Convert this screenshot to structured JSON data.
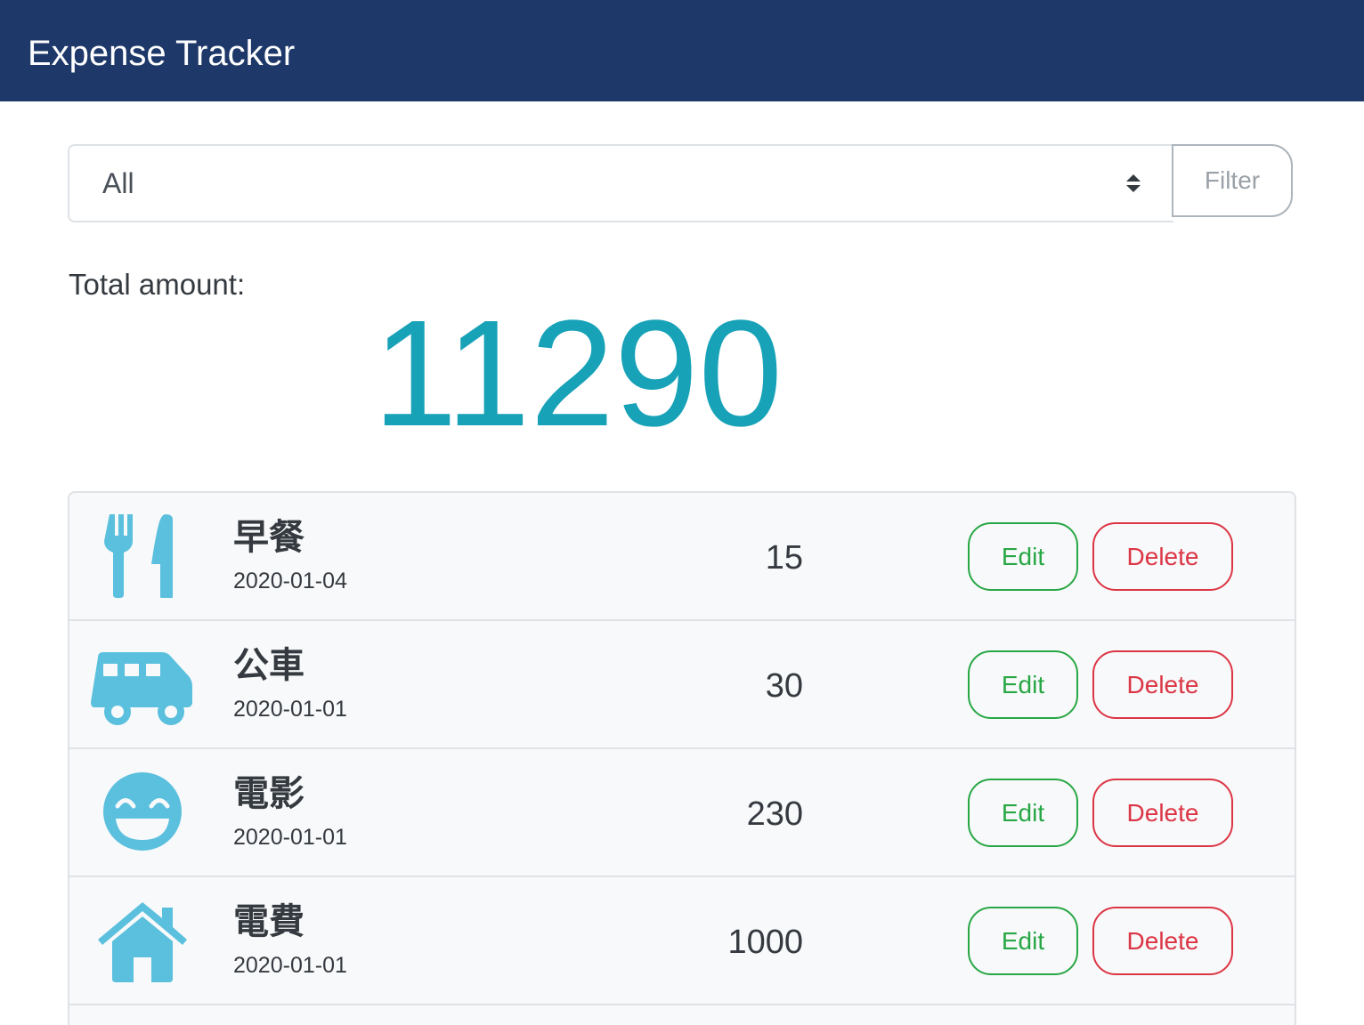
{
  "navbar": {
    "brand": "Expense Tracker"
  },
  "filter": {
    "selected": "All",
    "button_label": "Filter"
  },
  "total": {
    "label": "Total amount:",
    "value": "11290"
  },
  "colors": {
    "navbar": "#1e3869",
    "total_amount": "#17a2b8",
    "category_icon": "#5bc0de",
    "edit": "#28a745",
    "delete": "#dc3545"
  },
  "records": [
    {
      "icon": "utensils-icon",
      "name": "早餐",
      "date": "2020-01-04",
      "amount": "15",
      "edit_label": "Edit",
      "delete_label": "Delete"
    },
    {
      "icon": "shuttle-van-icon",
      "name": "公車",
      "date": "2020-01-01",
      "amount": "30",
      "edit_label": "Edit",
      "delete_label": "Delete"
    },
    {
      "icon": "grin-beam-icon",
      "name": "電影",
      "date": "2020-01-01",
      "amount": "230",
      "edit_label": "Edit",
      "delete_label": "Delete"
    },
    {
      "icon": "home-icon",
      "name": "電費",
      "date": "2020-01-01",
      "amount": "1000",
      "edit_label": "Edit",
      "delete_label": "Delete"
    }
  ]
}
